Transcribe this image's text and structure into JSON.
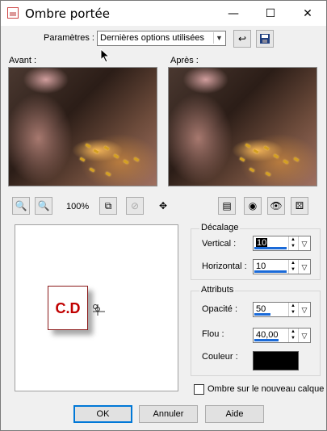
{
  "window": {
    "title": "Ombre portée",
    "controls": {
      "minimize": "—",
      "maximize": "☐",
      "close": "✕"
    }
  },
  "presets": {
    "label": "Paramètres :",
    "value": "Dernières options utilisées"
  },
  "previews": {
    "before_label": "Avant :",
    "after_label": "Après :"
  },
  "zoom": {
    "level": "100%"
  },
  "canvas": {
    "sample_text": "C.D"
  },
  "offset_group": {
    "title": "Décalage",
    "vertical_label": "Vertical :",
    "vertical_value": "10",
    "horizontal_label": "Horizontal :",
    "horizontal_value": "10"
  },
  "attributes_group": {
    "title": "Attributs",
    "opacity_label": "Opacité :",
    "opacity_value": "50",
    "blur_label": "Flou :",
    "blur_value": "40,00",
    "color_label": "Couleur :",
    "color_value": "#000000"
  },
  "new_layer_checkbox": {
    "label": "Ombre sur le nouveau calque",
    "checked": false
  },
  "buttons": {
    "ok": "OK",
    "cancel": "Annuler",
    "help": "Aide"
  }
}
